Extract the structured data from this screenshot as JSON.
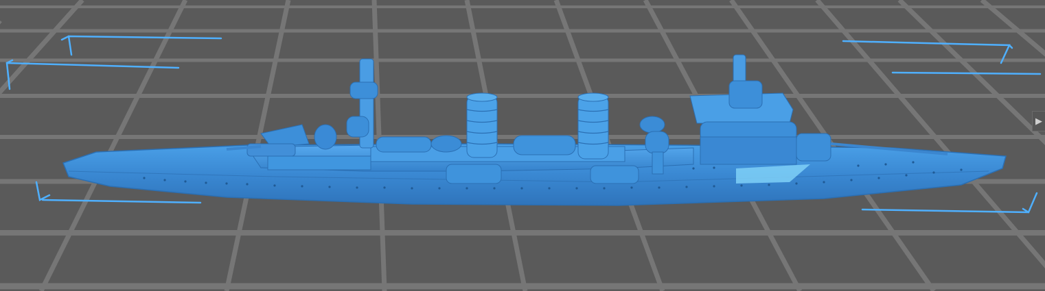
{
  "viewer": {
    "model_name": "",
    "background_color": "#5a5a5a",
    "grid_color": "#747474",
    "model_color": "#3e8fd8",
    "selection_color": "#4fb0ff"
  },
  "controls": {
    "panel_toggle_icon": "chevron-right-icon",
    "panel_toggle_glyph": "▶"
  }
}
